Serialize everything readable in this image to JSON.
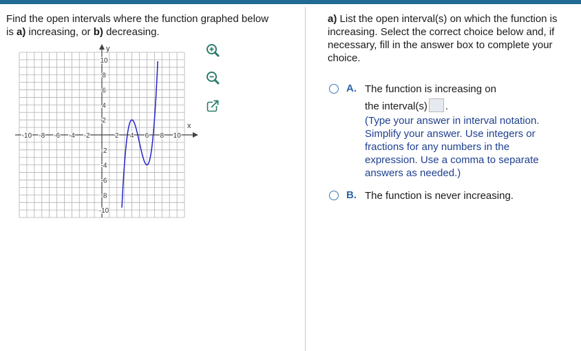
{
  "question": {
    "prefix": "Find the open intervals where the function graphed below",
    "line2_pre": "is ",
    "part_a_label": "a)",
    "part_a_text": " increasing, or ",
    "part_b_label": "b)",
    "part_b_text": " decreasing."
  },
  "graph": {
    "x_axis_label": "x",
    "y_axis_label": "y",
    "x_ticks": [
      "-10",
      "-8",
      "-6",
      "-4",
      "-2",
      "2",
      "4",
      "6",
      "8",
      "10"
    ],
    "y_ticks": [
      "10",
      "8",
      "6",
      "4",
      "2",
      "-2",
      "-4",
      "-6",
      "-8",
      "-10"
    ],
    "curve_color": "#2222cc",
    "grid_color": "#b0b0b0",
    "local_max": [
      4,
      2
    ],
    "local_min": [
      6,
      -4
    ]
  },
  "tools": {
    "zoom_in": "zoom-in-icon",
    "zoom_out": "zoom-out-icon",
    "popout": "popout-icon"
  },
  "part_a": {
    "label": "a)",
    "prompt": "List the open interval(s) on which the function is increasing. Select the correct choice below and, if necessary, fill in the answer box to complete your choice."
  },
  "choices": {
    "a": {
      "letter": "A.",
      "line1": "The function is increasing on",
      "line2": "the interval(s)",
      "period": ".",
      "instruction": "(Type your answer in interval notation. Simplify your answer. Use integers or fractions for any numbers in the expression. Use a comma to separate answers as needed.)"
    },
    "b": {
      "letter": "B.",
      "text": "The function is never increasing."
    }
  }
}
